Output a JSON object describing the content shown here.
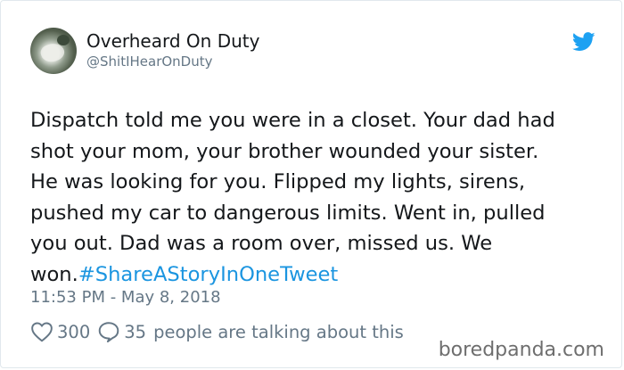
{
  "user": {
    "name": "Overheard On Duty",
    "handle": "@ShitIHearOnDuty"
  },
  "tweet": {
    "text": "Dispatch told me you were in a closet. Your dad had\nshot your mom, your brother wounded your sister.\nHe was looking for you. Flipped my lights, sirens,\npushed my car to dangerous limits. Went in, pulled\nyou out. Dad was a room over, missed us. We\nwon.",
    "hashtag": "#ShareAStoryInOneTweet",
    "timestamp": "11:53 PM - May 8, 2018"
  },
  "actions": {
    "likes": "300",
    "comments": "35",
    "talking_label": "people are talking about this"
  },
  "watermark": "boredpanda.com",
  "colors": {
    "accent": "#1b95e0",
    "muted": "#657786",
    "text": "#14171a"
  },
  "icons": [
    "twitter-bird-icon",
    "heart-icon",
    "comment-icon"
  ]
}
